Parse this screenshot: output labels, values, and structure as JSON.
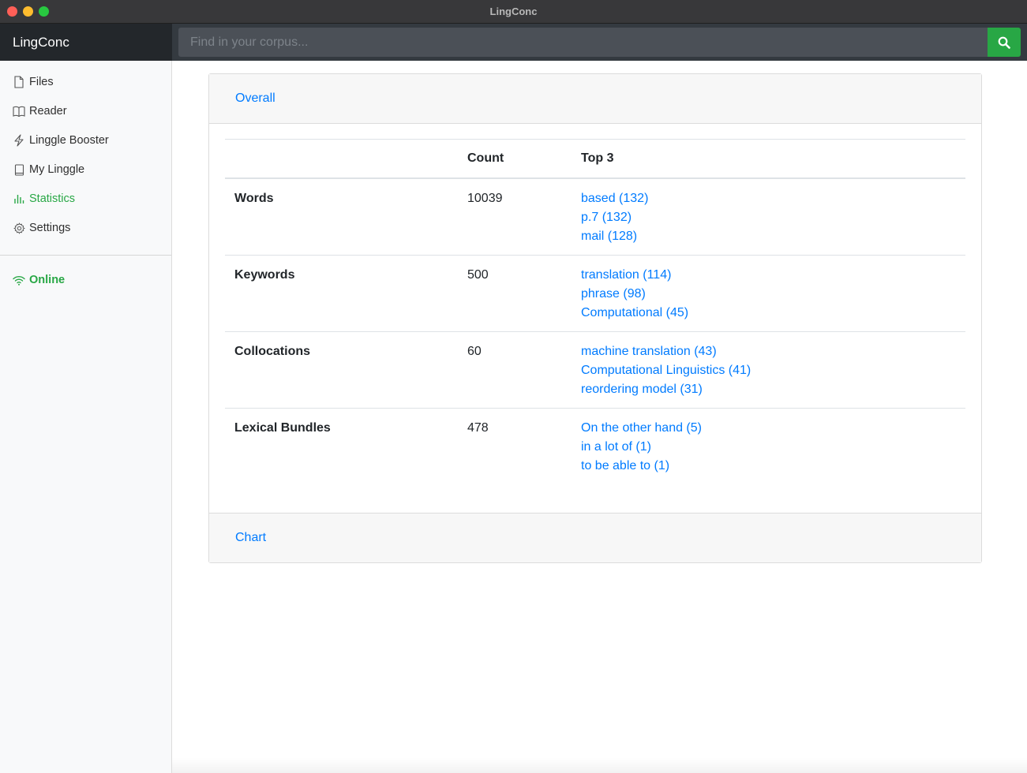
{
  "window": {
    "title": "LingConc"
  },
  "navbar": {
    "brand": "LingConc",
    "search_placeholder": "Find in your corpus...",
    "search_icon": "search-icon"
  },
  "sidebar": {
    "items": [
      {
        "label": "Files",
        "icon": "file-icon"
      },
      {
        "label": "Reader",
        "icon": "book-open-icon"
      },
      {
        "label": "Linggle Booster",
        "icon": "lightning-icon"
      },
      {
        "label": "My Linggle",
        "icon": "book-icon"
      },
      {
        "label": "Statistics",
        "icon": "bar-chart-icon",
        "active": true
      },
      {
        "label": "Settings",
        "icon": "gear-icon"
      }
    ],
    "status": {
      "label": "Online",
      "icon": "wifi-icon"
    }
  },
  "card": {
    "header_link": "Overall",
    "footer_link": "Chart",
    "table": {
      "headers": [
        "",
        "Count",
        "Top 3"
      ],
      "rows": [
        {
          "name": "Words",
          "count": "10039",
          "top": [
            "based (132)",
            "p.7 (132)",
            "mail (128)"
          ]
        },
        {
          "name": "Keywords",
          "count": "500",
          "top": [
            "translation (114)",
            "phrase (98)",
            "Computational (45)"
          ]
        },
        {
          "name": "Collocations",
          "count": "60",
          "top": [
            "machine translation (43)",
            "Computational Linguistics (41)",
            "reordering model (31)"
          ]
        },
        {
          "name": "Lexical Bundles",
          "count": "478",
          "top": [
            "On the other hand (5)",
            "in a lot of (1)",
            "to be able to (1)"
          ]
        }
      ]
    }
  },
  "colors": {
    "accent": "#28a745",
    "link": "#007bff",
    "navbar": "#343a40",
    "brand_bg": "#23272b"
  }
}
